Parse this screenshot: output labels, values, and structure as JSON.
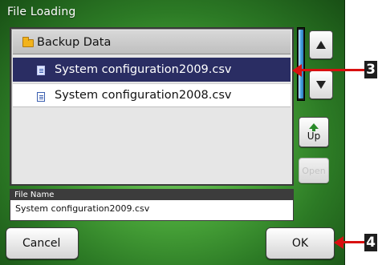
{
  "title": "File Loading",
  "folder": {
    "name": "Backup Data",
    "icon": "folder-icon"
  },
  "files": [
    {
      "name": "System configuration2009.csv",
      "selected": true,
      "icon": "document-icon"
    },
    {
      "name": "System configuration2008.csv",
      "selected": false,
      "icon": "document-icon"
    }
  ],
  "side_buttons": {
    "up_label": "Up",
    "open_label": "Open",
    "open_enabled": false
  },
  "file_name": {
    "header": "File Name",
    "value": "System configuration2009.csv"
  },
  "buttons": {
    "cancel": "Cancel",
    "ok": "OK"
  },
  "callouts": [
    "3",
    "4"
  ],
  "colors": {
    "selection": "#2a2d63",
    "callout": "#d81010",
    "background_green": "#4aa63a"
  }
}
